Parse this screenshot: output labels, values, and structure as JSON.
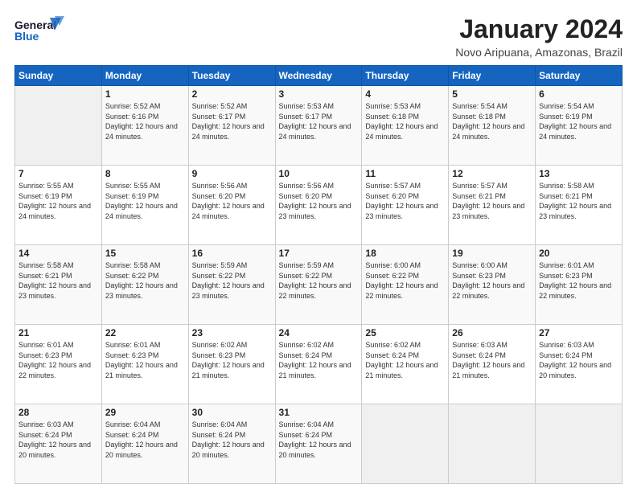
{
  "logo": {
    "line1": "General",
    "line2": "Blue"
  },
  "title": "January 2024",
  "location": "Novo Aripuana, Amazonas, Brazil",
  "headers": [
    "Sunday",
    "Monday",
    "Tuesday",
    "Wednesday",
    "Thursday",
    "Friday",
    "Saturday"
  ],
  "weeks": [
    [
      {
        "day": "",
        "sunrise": "",
        "sunset": "",
        "daylight": ""
      },
      {
        "day": "1",
        "sunrise": "Sunrise: 5:52 AM",
        "sunset": "Sunset: 6:16 PM",
        "daylight": "Daylight: 12 hours and 24 minutes."
      },
      {
        "day": "2",
        "sunrise": "Sunrise: 5:52 AM",
        "sunset": "Sunset: 6:17 PM",
        "daylight": "Daylight: 12 hours and 24 minutes."
      },
      {
        "day": "3",
        "sunrise": "Sunrise: 5:53 AM",
        "sunset": "Sunset: 6:17 PM",
        "daylight": "Daylight: 12 hours and 24 minutes."
      },
      {
        "day": "4",
        "sunrise": "Sunrise: 5:53 AM",
        "sunset": "Sunset: 6:18 PM",
        "daylight": "Daylight: 12 hours and 24 minutes."
      },
      {
        "day": "5",
        "sunrise": "Sunrise: 5:54 AM",
        "sunset": "Sunset: 6:18 PM",
        "daylight": "Daylight: 12 hours and 24 minutes."
      },
      {
        "day": "6",
        "sunrise": "Sunrise: 5:54 AM",
        "sunset": "Sunset: 6:19 PM",
        "daylight": "Daylight: 12 hours and 24 minutes."
      }
    ],
    [
      {
        "day": "7",
        "sunrise": "Sunrise: 5:55 AM",
        "sunset": "Sunset: 6:19 PM",
        "daylight": "Daylight: 12 hours and 24 minutes."
      },
      {
        "day": "8",
        "sunrise": "Sunrise: 5:55 AM",
        "sunset": "Sunset: 6:19 PM",
        "daylight": "Daylight: 12 hours and 24 minutes."
      },
      {
        "day": "9",
        "sunrise": "Sunrise: 5:56 AM",
        "sunset": "Sunset: 6:20 PM",
        "daylight": "Daylight: 12 hours and 24 minutes."
      },
      {
        "day": "10",
        "sunrise": "Sunrise: 5:56 AM",
        "sunset": "Sunset: 6:20 PM",
        "daylight": "Daylight: 12 hours and 23 minutes."
      },
      {
        "day": "11",
        "sunrise": "Sunrise: 5:57 AM",
        "sunset": "Sunset: 6:20 PM",
        "daylight": "Daylight: 12 hours and 23 minutes."
      },
      {
        "day": "12",
        "sunrise": "Sunrise: 5:57 AM",
        "sunset": "Sunset: 6:21 PM",
        "daylight": "Daylight: 12 hours and 23 minutes."
      },
      {
        "day": "13",
        "sunrise": "Sunrise: 5:58 AM",
        "sunset": "Sunset: 6:21 PM",
        "daylight": "Daylight: 12 hours and 23 minutes."
      }
    ],
    [
      {
        "day": "14",
        "sunrise": "Sunrise: 5:58 AM",
        "sunset": "Sunset: 6:21 PM",
        "daylight": "Daylight: 12 hours and 23 minutes."
      },
      {
        "day": "15",
        "sunrise": "Sunrise: 5:58 AM",
        "sunset": "Sunset: 6:22 PM",
        "daylight": "Daylight: 12 hours and 23 minutes."
      },
      {
        "day": "16",
        "sunrise": "Sunrise: 5:59 AM",
        "sunset": "Sunset: 6:22 PM",
        "daylight": "Daylight: 12 hours and 23 minutes."
      },
      {
        "day": "17",
        "sunrise": "Sunrise: 5:59 AM",
        "sunset": "Sunset: 6:22 PM",
        "daylight": "Daylight: 12 hours and 22 minutes."
      },
      {
        "day": "18",
        "sunrise": "Sunrise: 6:00 AM",
        "sunset": "Sunset: 6:22 PM",
        "daylight": "Daylight: 12 hours and 22 minutes."
      },
      {
        "day": "19",
        "sunrise": "Sunrise: 6:00 AM",
        "sunset": "Sunset: 6:23 PM",
        "daylight": "Daylight: 12 hours and 22 minutes."
      },
      {
        "day": "20",
        "sunrise": "Sunrise: 6:01 AM",
        "sunset": "Sunset: 6:23 PM",
        "daylight": "Daylight: 12 hours and 22 minutes."
      }
    ],
    [
      {
        "day": "21",
        "sunrise": "Sunrise: 6:01 AM",
        "sunset": "Sunset: 6:23 PM",
        "daylight": "Daylight: 12 hours and 22 minutes."
      },
      {
        "day": "22",
        "sunrise": "Sunrise: 6:01 AM",
        "sunset": "Sunset: 6:23 PM",
        "daylight": "Daylight: 12 hours and 21 minutes."
      },
      {
        "day": "23",
        "sunrise": "Sunrise: 6:02 AM",
        "sunset": "Sunset: 6:23 PM",
        "daylight": "Daylight: 12 hours and 21 minutes."
      },
      {
        "day": "24",
        "sunrise": "Sunrise: 6:02 AM",
        "sunset": "Sunset: 6:24 PM",
        "daylight": "Daylight: 12 hours and 21 minutes."
      },
      {
        "day": "25",
        "sunrise": "Sunrise: 6:02 AM",
        "sunset": "Sunset: 6:24 PM",
        "daylight": "Daylight: 12 hours and 21 minutes."
      },
      {
        "day": "26",
        "sunrise": "Sunrise: 6:03 AM",
        "sunset": "Sunset: 6:24 PM",
        "daylight": "Daylight: 12 hours and 21 minutes."
      },
      {
        "day": "27",
        "sunrise": "Sunrise: 6:03 AM",
        "sunset": "Sunset: 6:24 PM",
        "daylight": "Daylight: 12 hours and 20 minutes."
      }
    ],
    [
      {
        "day": "28",
        "sunrise": "Sunrise: 6:03 AM",
        "sunset": "Sunset: 6:24 PM",
        "daylight": "Daylight: 12 hours and 20 minutes."
      },
      {
        "day": "29",
        "sunrise": "Sunrise: 6:04 AM",
        "sunset": "Sunset: 6:24 PM",
        "daylight": "Daylight: 12 hours and 20 minutes."
      },
      {
        "day": "30",
        "sunrise": "Sunrise: 6:04 AM",
        "sunset": "Sunset: 6:24 PM",
        "daylight": "Daylight: 12 hours and 20 minutes."
      },
      {
        "day": "31",
        "sunrise": "Sunrise: 6:04 AM",
        "sunset": "Sunset: 6:24 PM",
        "daylight": "Daylight: 12 hours and 20 minutes."
      },
      {
        "day": "",
        "sunrise": "",
        "sunset": "",
        "daylight": ""
      },
      {
        "day": "",
        "sunrise": "",
        "sunset": "",
        "daylight": ""
      },
      {
        "day": "",
        "sunrise": "",
        "sunset": "",
        "daylight": ""
      }
    ]
  ]
}
